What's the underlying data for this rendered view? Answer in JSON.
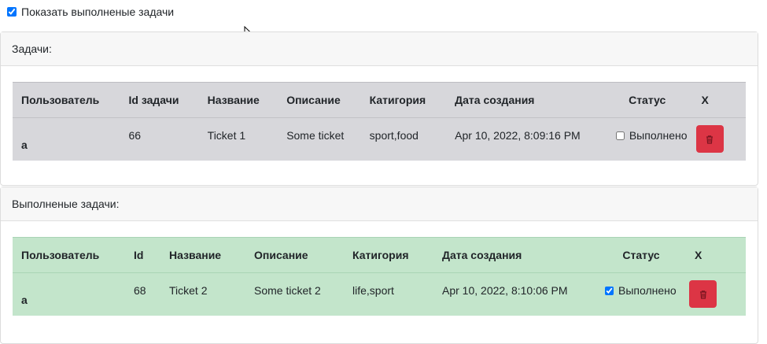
{
  "top_toggle": {
    "label": "Показать выполненые задачи",
    "checked": true
  },
  "tasks_section": {
    "title": "Задачи:",
    "columns": [
      "Пользователь",
      "Id задачи",
      "Название",
      "Описание",
      "Катигория",
      "Дата создания",
      "Статус",
      "X"
    ],
    "rows": [
      {
        "user": "a",
        "id": "66",
        "name": "Ticket 1",
        "description": "Some ticket",
        "category": "sport,food",
        "created": "Apr 10, 2022, 8:09:16 PM",
        "status_label": "Выполнено",
        "done": false
      }
    ],
    "row_color": "#d7d7db"
  },
  "done_section": {
    "title": "Выполненые задачи:",
    "columns": [
      "Пользователь",
      "Id",
      "Название",
      "Описание",
      "Катигория",
      "Дата создания",
      "Статус",
      "X"
    ],
    "rows": [
      {
        "user": "a",
        "id": "68",
        "name": "Ticket 2",
        "description": "Some ticket 2",
        "category": "life,sport",
        "created": "Apr 10, 2022, 8:10:06 PM",
        "status_label": "Выполнено",
        "done": true
      }
    ],
    "row_color": "#c3e5cb"
  },
  "colors": {
    "delete_button": "#dc3545",
    "checkbox_accent": "#0d6efd"
  },
  "icons": {
    "delete": "trash-icon"
  }
}
